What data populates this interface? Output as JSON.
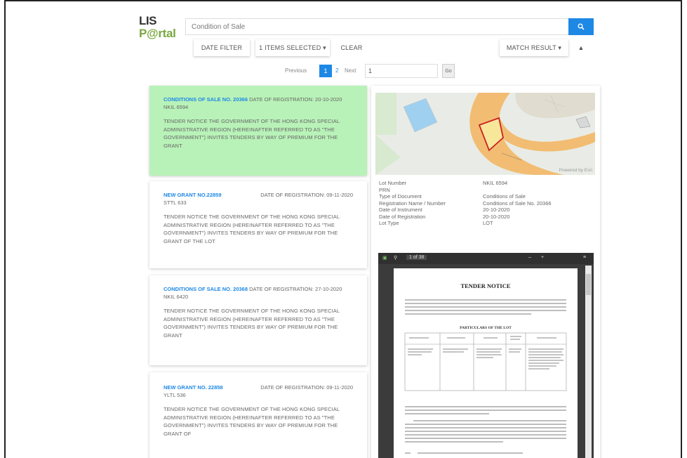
{
  "header": {
    "logo_line1": "LIS",
    "logo_line2": "P@rtal",
    "search_value": "Condition of Sale",
    "search_icon": "search-icon"
  },
  "toolbar": {
    "date_filter": "DATE FILTER",
    "items_selected": "1 ITEMS SELECTED ▾",
    "clear": "CLEAR",
    "match_result": "MATCH RESULT ▾",
    "sort_up": "▲"
  },
  "pagination": {
    "previous": "Previous",
    "page_current": "1",
    "page_2": "2",
    "next": "Next",
    "jump_value": "1",
    "go": "Go"
  },
  "results": [
    {
      "id": "CONDITIONS OF SALE NO. 20366",
      "date": "DATE OF REGISTRATION: 20-10-2020",
      "lot": "NKIL 6594",
      "text": "TENDER NOTICE THE GOVERNMENT OF THE HONG KONG SPECIAL ADMINISTRATIVE REGION (HEREINAFTER REFERRED TO AS \"THE GOVERNMENT\") INVITES TENDERS BY WAY OF PREMIUM FOR THE GRANT"
    },
    {
      "id": "NEW GRANT NO.22859",
      "date": "DATE OF REGISTRATION: 09-11-2020",
      "lot": "STTL 633",
      "text": "TENDER NOTICE THE GOVERNMENT OF THE HONG KONG SPECIAL ADMINISTRATIVE REGION (HEREINAFTER REFERRED TO AS \"THE GOVERNMENT\") INVITES TENDERS BY WAY OF PREMIUM FOR THE GRANT OF THE LOT"
    },
    {
      "id": "CONDITIONS OF SALE NO. 20368",
      "date": "DATE OF REGISTRATION: 27-10-2020",
      "lot": "NKIL 6420",
      "text": "TENDER NOTICE THE GOVERNMENT OF THE HONG KONG SPECIAL ADMINISTRATIVE REGION (HEREINAFTER REFERRED TO AS \"THE GOVERNMENT\") INVITES TENDERS BY WAY OF PREMIUM FOR THE GRANT"
    },
    {
      "id": "NEW GRANT NO. 22858",
      "date": "DATE OF REGISTRATION: 09-11-2020",
      "lot": "YLTL 536",
      "text": "TENDER NOTICE THE GOVERNMENT OF THE HONG KONG SPECIAL ADMINISTRATIVE REGION (HEREINAFTER REFERRED TO AS \"THE GOVERNMENT\") INVITES TENDERS BY WAY OF PREMIUM FOR THE GRANT OF"
    }
  ],
  "detail": {
    "map_credit": "Powered by Esri",
    "rows": [
      {
        "key": "Lot Number",
        "value": "NKIL 6594"
      },
      {
        "key": "PRN",
        "value": ""
      },
      {
        "key": "Type of Document",
        "value": "Conditions of Sale"
      },
      {
        "key": "Registration Name / Number",
        "value": "Conditions of Sale No. 20366"
      },
      {
        "key": "Date of Instrument",
        "value": "20-10-2020"
      },
      {
        "key": "Date of Registration",
        "value": "20-10-2020"
      },
      {
        "key": "Lot Type",
        "value": "LOT"
      }
    ],
    "pdf": {
      "page_indicator": "1 of 38",
      "doc_title": "TENDER NOTICE",
      "doc_subtitle": "PARTICULARS OF THE LOT"
    }
  },
  "colors": {
    "accent": "#1e88e5",
    "active_card": "#b8f2b8",
    "logo_green": "#7aa840"
  }
}
